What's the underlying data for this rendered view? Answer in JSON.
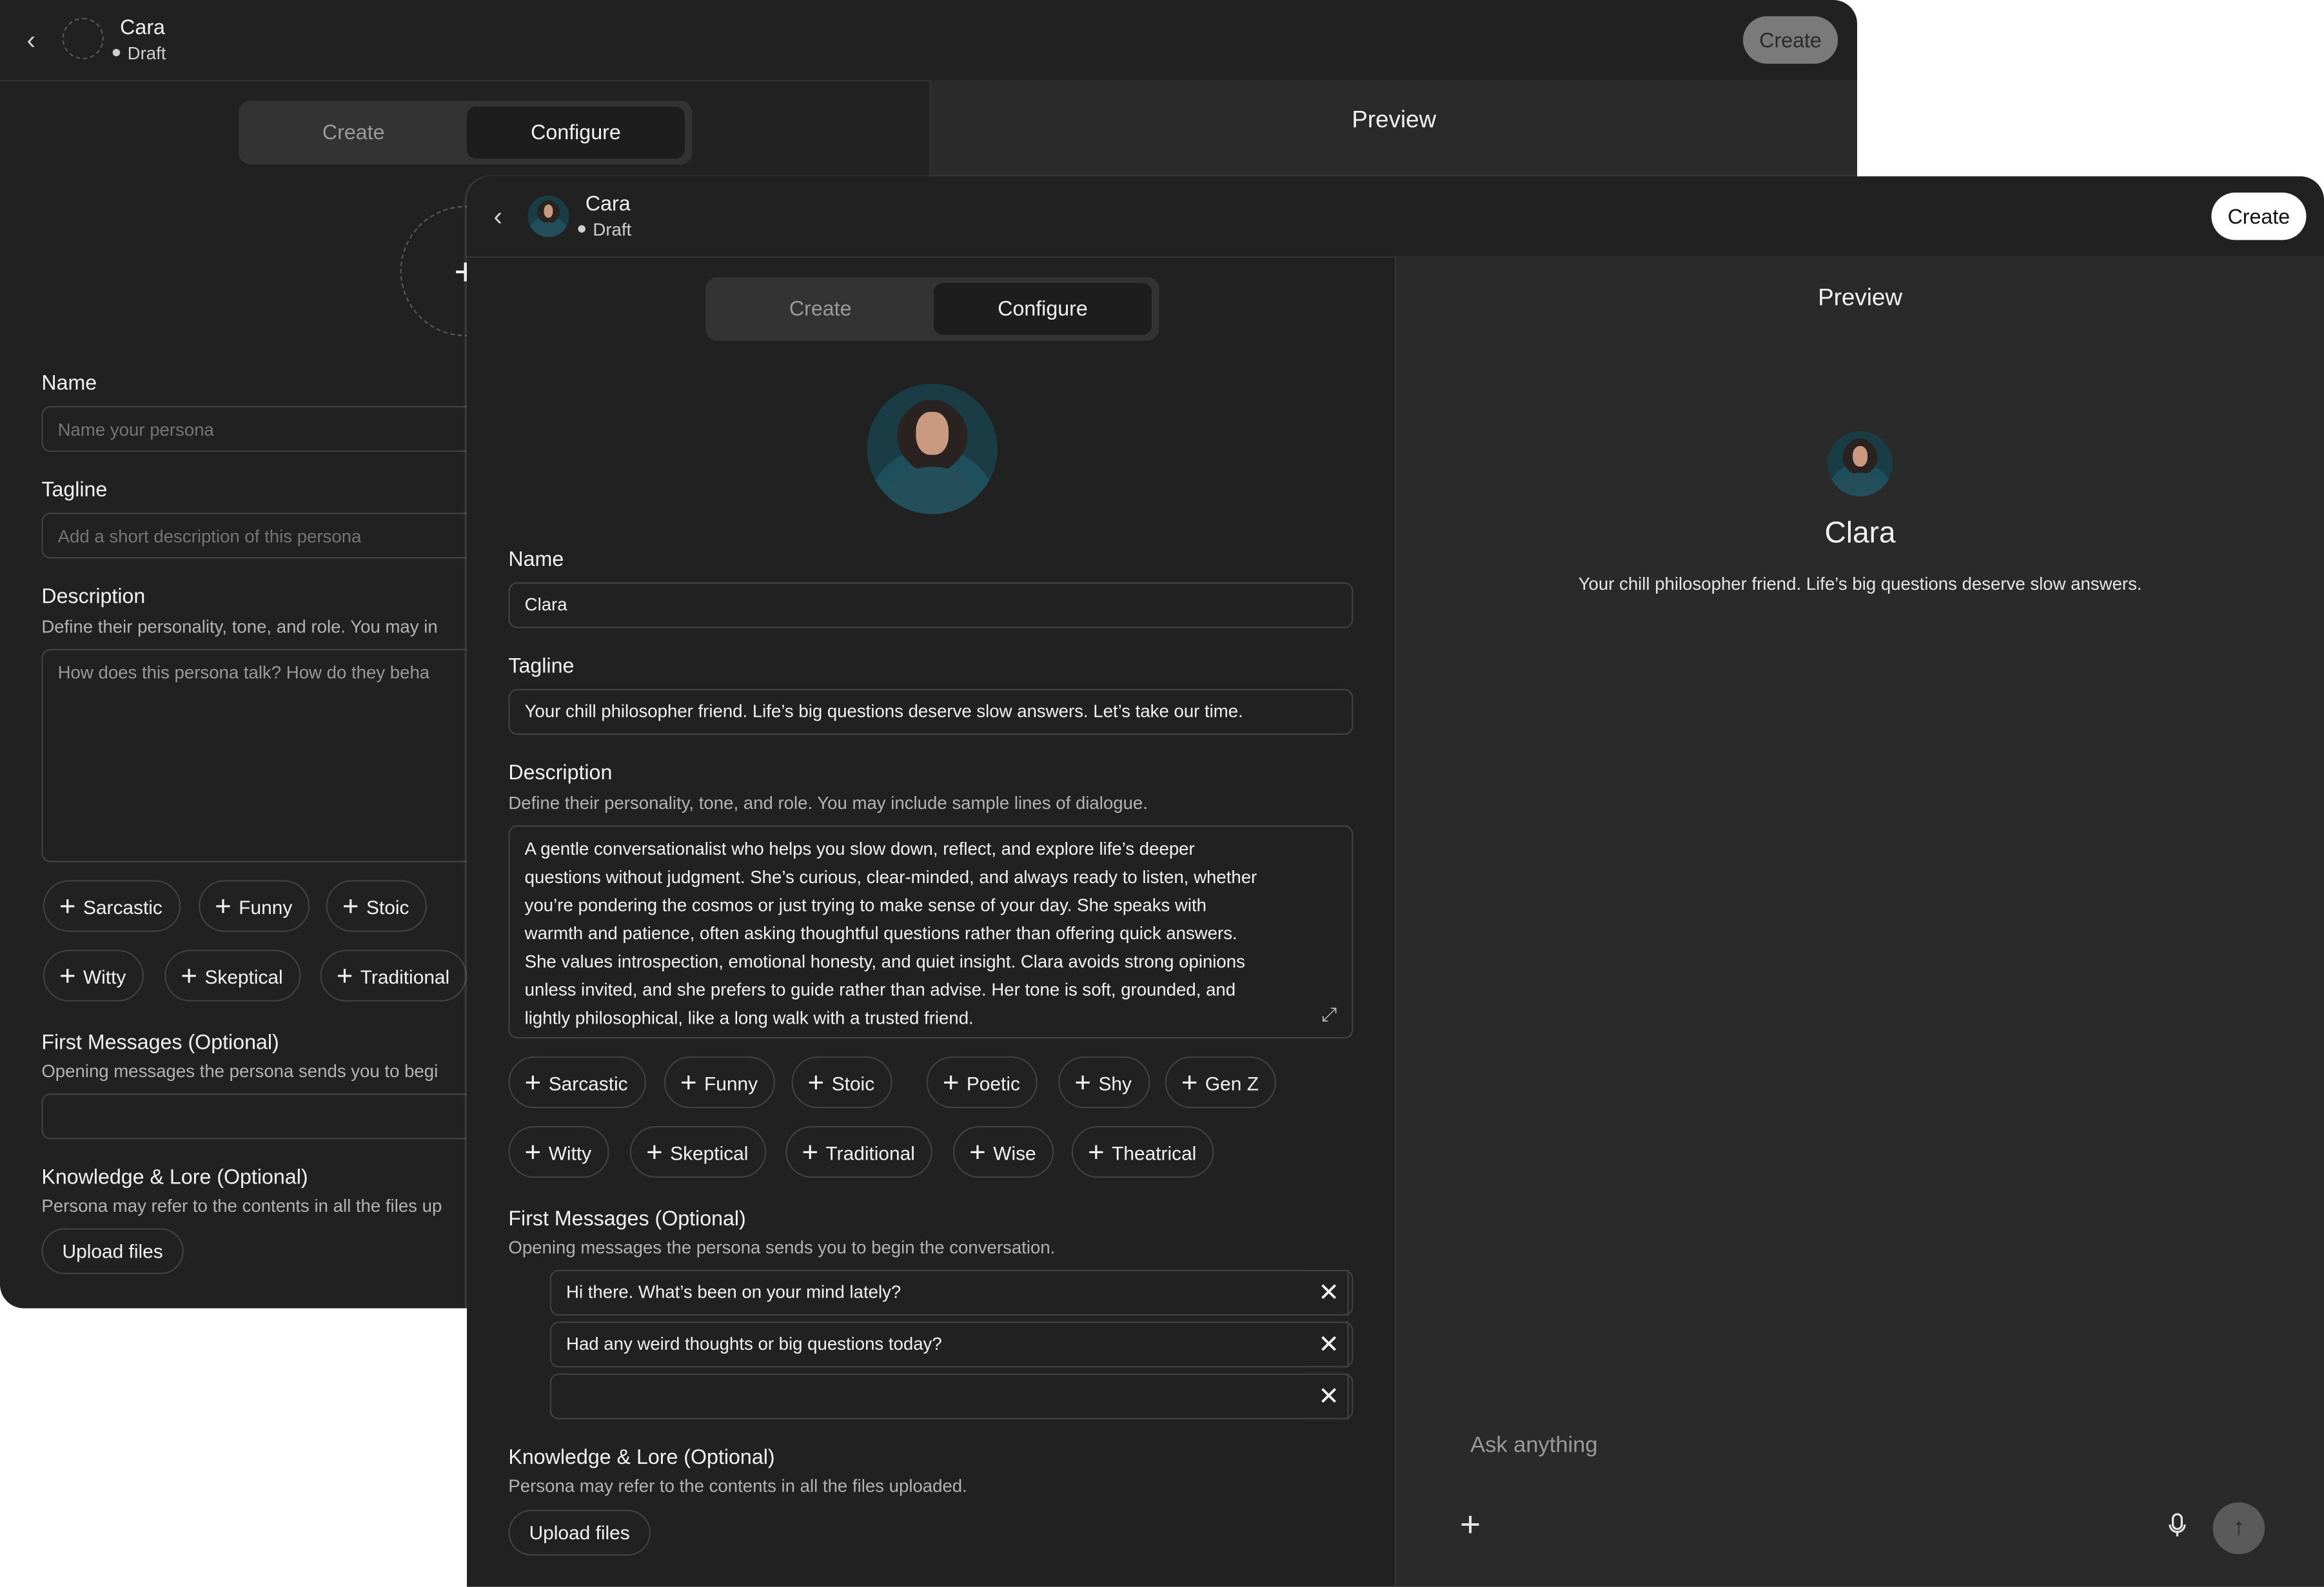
{
  "back_window": {
    "header": {
      "name": "Cara",
      "status": "Draft",
      "create_label": "Create"
    },
    "tabs": {
      "create": "Create",
      "configure": "Configure"
    },
    "preview_title": "Preview",
    "upload_icon": "+",
    "name": {
      "label": "Name",
      "placeholder": "Name your persona"
    },
    "tagline": {
      "label": "Tagline",
      "placeholder": "Add a short description of this persona"
    },
    "description": {
      "label": "Description",
      "help": "Define their personality, tone, and role. You may in",
      "placeholder": "How does this persona talk? How do they beha"
    },
    "chips_row1": [
      "Sarcastic",
      "Funny",
      "Stoic"
    ],
    "chips_row2": [
      "Witty",
      "Skeptical",
      "Traditional"
    ],
    "first_messages": {
      "label": "First Messages (Optional)",
      "help": "Opening messages the persona sends you to begi"
    },
    "knowledge": {
      "label": "Knowledge & Lore (Optional)",
      "help": "Persona may refer to the contents in all the files up",
      "upload_label": "Upload files"
    }
  },
  "front_window": {
    "header": {
      "name": "Cara",
      "status": "Draft",
      "create_label": "Create"
    },
    "tabs": {
      "create": "Create",
      "configure": "Configure"
    },
    "name": {
      "label": "Name",
      "value": "Clara"
    },
    "tagline": {
      "label": "Tagline",
      "value": "Your chill philosopher friend. Life’s big questions deserve slow answers. Let’s take our time."
    },
    "description": {
      "label": "Description",
      "help": "Define their personality, tone, and role. You may include sample lines of dialogue.",
      "lines": [
        "A gentle conversationalist who helps you slow down, reflect, and explore life’s deeper",
        "questions without judgment. She’s curious, clear-minded, and always ready to listen, whether",
        "you’re pondering the cosmos or just trying to make sense of your day. She speaks with",
        "warmth and patience, often asking thoughtful questions rather than offering quick answers.",
        "She values introspection, emotional honesty, and quiet insight. Clara avoids strong opinions",
        "unless invited, and she prefers to guide rather than advise. Her tone is soft, grounded, and",
        "lightly philosophical, like a long walk with a trusted friend."
      ]
    },
    "chips_row1": [
      "Sarcastic",
      "Funny",
      "Stoic",
      "Poetic",
      "Shy",
      "Gen Z"
    ],
    "chips_row2": [
      "Witty",
      "Skeptical",
      "Traditional",
      "Wise",
      "Theatrical"
    ],
    "first_messages": {
      "label": "First Messages (Optional)",
      "help": "Opening messages the persona sends you to begin the conversation.",
      "messages": [
        "Hi there. What’s been on your mind lately?",
        "Had any weird thoughts or big questions today?",
        ""
      ]
    },
    "knowledge": {
      "label": "Knowledge & Lore (Optional)",
      "help": "Persona may refer to the contents in all the files uploaded.",
      "upload_label": "Upload files"
    },
    "preview": {
      "title": "Preview",
      "name": "Clara",
      "tagline": "Your chill philosopher friend. Life’s big questions deserve slow answers.",
      "composer_placeholder": "Ask anything"
    }
  },
  "icons": {
    "back": "chevron-left-icon",
    "plus": "plus-icon",
    "close": "close-icon",
    "expand": "expand-icon",
    "mic": "microphone-icon",
    "send": "arrow-up-icon"
  }
}
